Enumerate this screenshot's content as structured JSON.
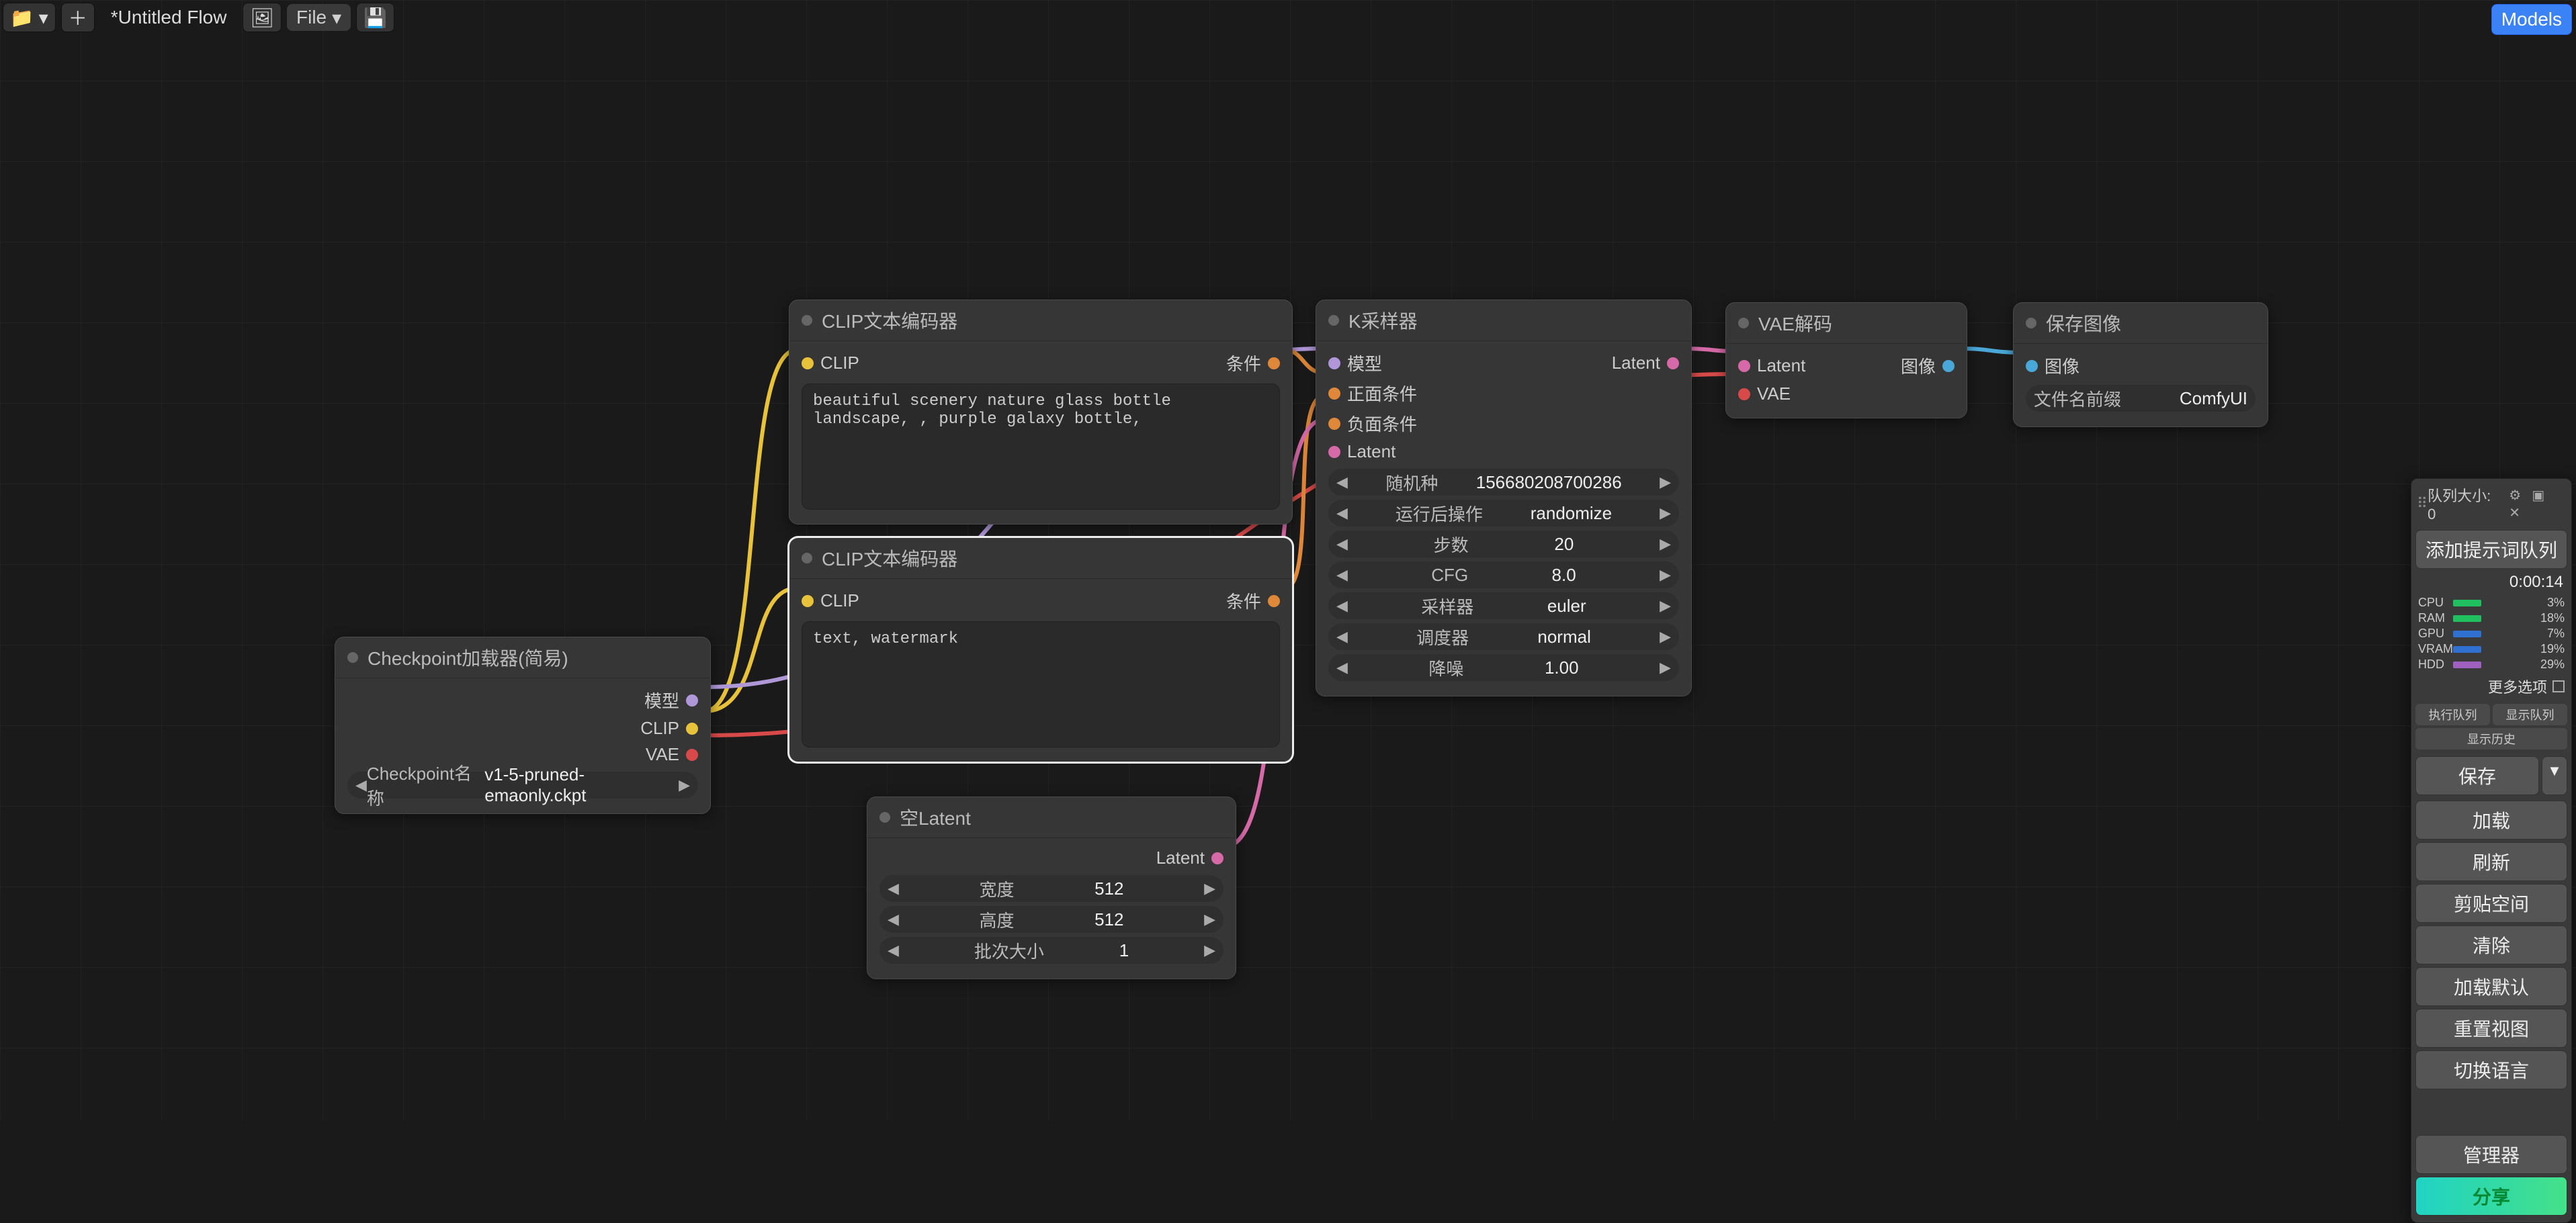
{
  "topbar": {
    "title": "*Untitled Flow",
    "file_label": "File",
    "models_label": "Models"
  },
  "nodes": {
    "checkpoint": {
      "title": "Checkpoint加载器(简易)",
      "outputs": {
        "model": "模型",
        "clip": "CLIP",
        "vae": "VAE"
      },
      "widget_label": "Checkpoint名称",
      "widget_value": "v1-5-pruned-emaonly.ckpt"
    },
    "clip_pos": {
      "title": "CLIP文本编码器",
      "in_clip": "CLIP",
      "out_cond": "条件",
      "text": "beautiful scenery nature glass bottle landscape, , purple galaxy bottle,"
    },
    "clip_neg": {
      "title": "CLIP文本编码器",
      "in_clip": "CLIP",
      "out_cond": "条件",
      "text": "text, watermark"
    },
    "empty_latent": {
      "title": "空Latent",
      "out_latent": "Latent",
      "width_label": "宽度",
      "width_value": "512",
      "height_label": "高度",
      "height_value": "512",
      "batch_label": "批次大小",
      "batch_value": "1"
    },
    "ksampler": {
      "title": "K采样器",
      "in_model": "模型",
      "in_pos": "正面条件",
      "in_neg": "负面条件",
      "in_latent": "Latent",
      "out_latent": "Latent",
      "seed_label": "随机种",
      "seed_value": "156680208700286",
      "after_label": "运行后操作",
      "after_value": "randomize",
      "steps_label": "步数",
      "steps_value": "20",
      "cfg_label": "CFG",
      "cfg_value": "8.0",
      "sampler_label": "采样器",
      "sampler_value": "euler",
      "scheduler_label": "调度器",
      "scheduler_value": "normal",
      "denoise_label": "降噪",
      "denoise_value": "1.00"
    },
    "vae_decode": {
      "title": "VAE解码",
      "in_latent": "Latent",
      "in_vae": "VAE",
      "out_image": "图像"
    },
    "save_image": {
      "title": "保存图像",
      "in_image": "图像",
      "prefix_label": "文件名前缀",
      "prefix_value": "ComfyUI"
    }
  },
  "panel": {
    "queue_label": "队列大小: 0",
    "add_prompt": "添加提示词队列",
    "timer": "0:00:14",
    "stats": [
      {
        "name": "CPU",
        "pct": "3%",
        "color": "#20c060"
      },
      {
        "name": "RAM",
        "pct": "18%",
        "color": "#20c060"
      },
      {
        "name": "GPU",
        "pct": "7%",
        "color": "#3070d0"
      },
      {
        "name": "VRAM",
        "pct": "19%",
        "color": "#3070d0"
      },
      {
        "name": "HDD",
        "pct": "29%",
        "color": "#a060c0"
      }
    ],
    "more_options": "更多选项",
    "run_queue": "执行队列",
    "show_queue": "显示队列",
    "show_history": "显示历史",
    "save": "保存",
    "load": "加载",
    "refresh": "刷新",
    "clipboard": "剪贴空间",
    "clear": "清除",
    "load_default": "加载默认",
    "reset_view": "重置视图",
    "switch_lang": "切换语言",
    "manager": "管理器",
    "share": "分享"
  }
}
